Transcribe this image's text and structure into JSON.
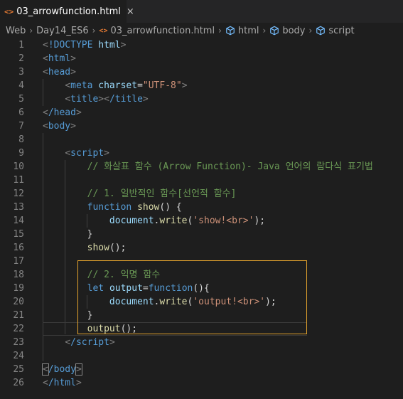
{
  "tab": {
    "icon": "<>",
    "label": "03_arrowfunction.html",
    "close": "×"
  },
  "breadcrumb": {
    "items": [
      "Web",
      "Day14_ES6",
      "03_arrowfunction.html",
      "html",
      "body",
      "script"
    ],
    "separator": "›"
  },
  "lines": [
    {
      "n": "1"
    },
    {
      "n": "2"
    },
    {
      "n": "3"
    },
    {
      "n": "4"
    },
    {
      "n": "5"
    },
    {
      "n": "6"
    },
    {
      "n": "7"
    },
    {
      "n": "8"
    },
    {
      "n": "9"
    },
    {
      "n": "10"
    },
    {
      "n": "11"
    },
    {
      "n": "12"
    },
    {
      "n": "13"
    },
    {
      "n": "14"
    },
    {
      "n": "15"
    },
    {
      "n": "16"
    },
    {
      "n": "17"
    },
    {
      "n": "18"
    },
    {
      "n": "19"
    },
    {
      "n": "20"
    },
    {
      "n": "21"
    },
    {
      "n": "22"
    },
    {
      "n": "23"
    },
    {
      "n": "24"
    },
    {
      "n": "25"
    },
    {
      "n": "26"
    }
  ],
  "code": {
    "doctype": "!DOCTYPE",
    "doctype_html": "html",
    "html": "html",
    "head": "head",
    "meta": "meta",
    "charset_attr": "charset",
    "charset_val": "\"UTF-8\"",
    "title": "title",
    "title_close": "/title",
    "head_close": "/head",
    "body": "body",
    "script": "script",
    "comment_arrow": "// 화살표 함수 (Arrow Function)- Java 언어의 람다식 표기법",
    "comment_normal": "// 1. 일반적인 함수[선언적 함수]",
    "kw_function": "function",
    "fn_show": "show",
    "doc": "document",
    "write": "write",
    "str_show": "'show!<br>'",
    "comment_anon": "// 2. 익명 함수",
    "kw_let": "let",
    "var_output": "output",
    "str_output": "'output!<br>'",
    "script_close": "/script",
    "body_close": "/body",
    "html_close": "/html"
  }
}
